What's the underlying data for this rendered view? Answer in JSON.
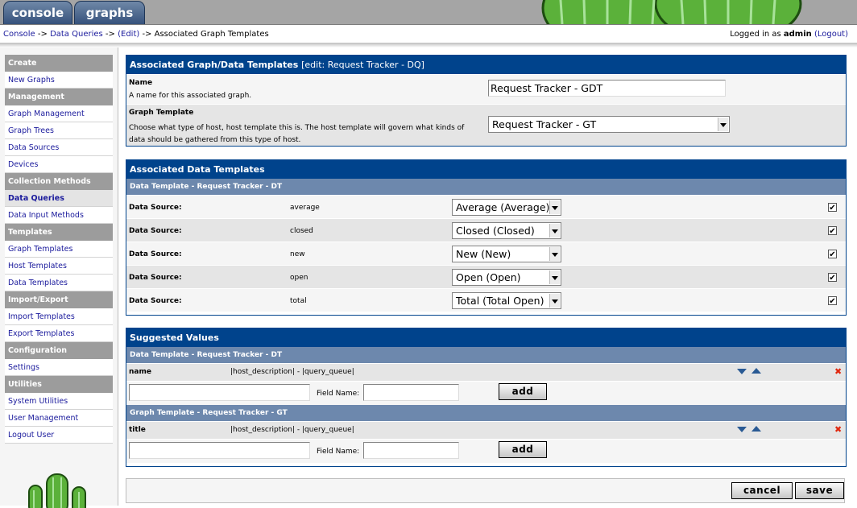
{
  "tabs": {
    "console": "console",
    "graphs": "graphs"
  },
  "breadcrumb": {
    "console": "Console",
    "sep1": " -> ",
    "data_queries": "Data Queries",
    "sep2": " -> ",
    "edit": "(Edit)",
    "sep3": " -> ",
    "current": "Associated Graph Templates"
  },
  "login": {
    "prefix": "Logged in as ",
    "user": "admin",
    "logout": "(Logout)"
  },
  "sidebar": {
    "create": "Create",
    "new_graphs": "New Graphs",
    "management": "Management",
    "graph_management": "Graph Management",
    "graph_trees": "Graph Trees",
    "data_sources": "Data Sources",
    "devices": "Devices",
    "collection_methods": "Collection Methods",
    "data_queries": "Data Queries",
    "data_input_methods": "Data Input Methods",
    "templates": "Templates",
    "graph_templates": "Graph Templates",
    "host_templates": "Host Templates",
    "data_templates": "Data Templates",
    "import_export": "Import/Export",
    "import_templates": "Import Templates",
    "export_templates": "Export Templates",
    "configuration": "Configuration",
    "settings": "Settings",
    "utilities": "Utilities",
    "system_utilities": "System Utilities",
    "user_management": "User Management",
    "logout_user": "Logout User"
  },
  "assoc": {
    "title": "Associated Graph/Data Templates",
    "subtitle": "[edit: Request Tracker - DQ]",
    "name_label": "Name",
    "name_desc": "A name for this associated graph.",
    "name_value": "Request Tracker - GDT",
    "gt_label": "Graph Template",
    "gt_desc": "Choose what type of host, host template this is. The host template will govern what kinds of data should be gathered from this type of host.",
    "gt_value": "Request Tracker - GT"
  },
  "data_templates": {
    "title": "Associated Data Templates",
    "sub": "Data Template - Request Tracker - DT",
    "rows": [
      {
        "label": "Data Source:",
        "name": "average",
        "value": "Average (Average)",
        "checked": "✔"
      },
      {
        "label": "Data Source:",
        "name": "closed",
        "value": "Closed (Closed)",
        "checked": "✔"
      },
      {
        "label": "Data Source:",
        "name": "new",
        "value": "New (New)",
        "checked": "✔"
      },
      {
        "label": "Data Source:",
        "name": "open",
        "value": "Open (Open)",
        "checked": "✔"
      },
      {
        "label": "Data Source:",
        "name": "total",
        "value": "Total (Total Open)",
        "checked": "✔"
      }
    ]
  },
  "suggested": {
    "title": "Suggested Values",
    "dt_sub": "Data Template - Request Tracker - DT",
    "dt_field": "name",
    "dt_value": "|host_description| - |query_queue|",
    "gt_sub": "Graph Template - Request Tracker - GT",
    "gt_field": "title",
    "gt_value": "|host_description| - |query_queue|",
    "field_name_label": "Field Name:",
    "add_label": "add",
    "delete_icon": "✖"
  },
  "actions": {
    "cancel": "cancel",
    "save": "save"
  }
}
